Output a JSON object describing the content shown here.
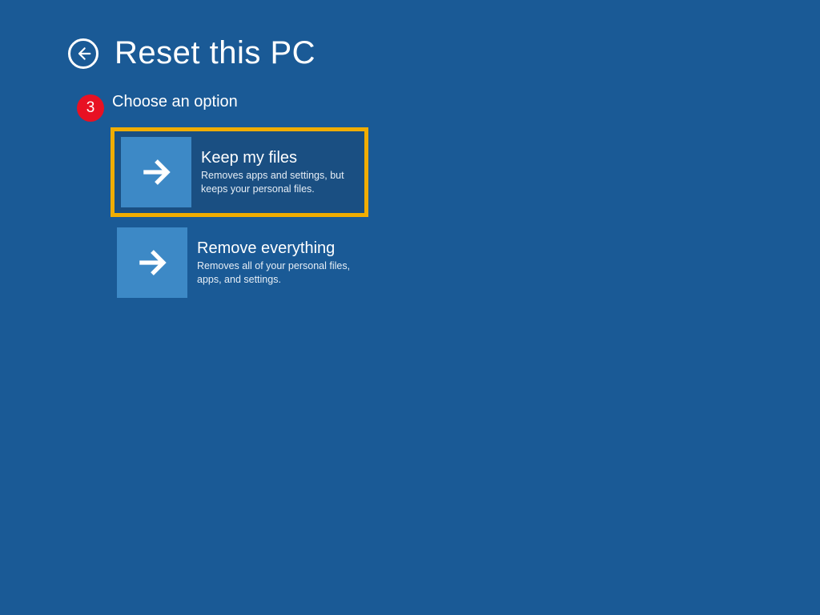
{
  "header": {
    "title": "Reset this PC"
  },
  "subtitle": "Choose an option",
  "options": [
    {
      "title": "Keep my files",
      "description": "Removes apps and settings, but keeps your personal files.",
      "highlighted": true
    },
    {
      "title": "Remove everything",
      "description": "Removes all of your personal files, apps, and settings.",
      "highlighted": false
    }
  ],
  "annotation": {
    "number": "3"
  },
  "colors": {
    "background": "#1a5a96",
    "tile": "#3d89c6",
    "highlight": "#f0ad00",
    "badge": "#e81123"
  }
}
